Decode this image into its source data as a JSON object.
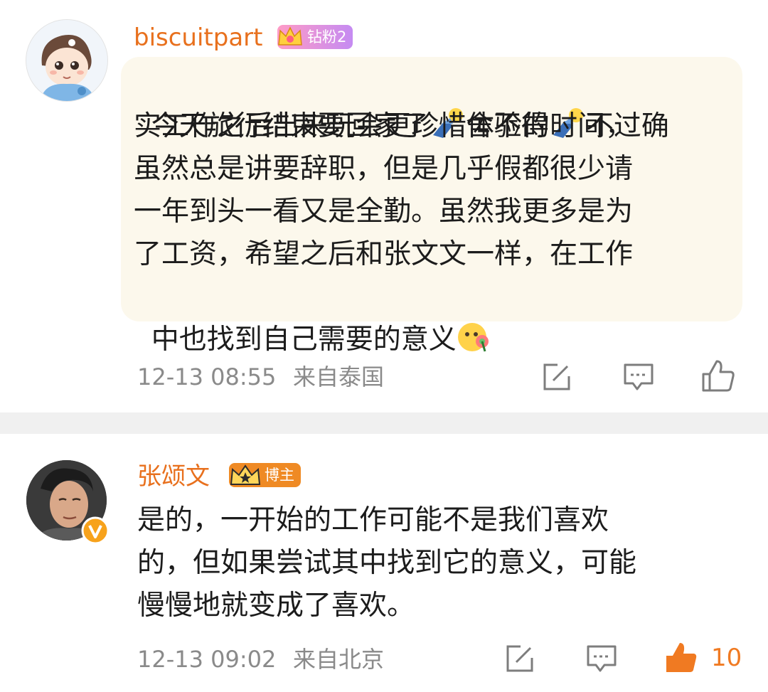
{
  "comment1": {
    "username": "biscuitpart",
    "badge_label": "钻粉2",
    "lines": [
      "今天旅行结束要回家了",
      "实工作之后出来玩会更珍惜体验的时间，",
      "虽然总是讲要辞职，但是几乎假都很少请",
      "一年到头一看又是全勤。虽然我更多是为",
      "了工资，希望之后和张文文一样，在工作",
      "中也找到自己需要的意义"
    ],
    "line1_mid": "舍不得",
    "line1_end": "不过确",
    "timestamp": "12-13 08:55",
    "location": "来自泰国"
  },
  "comment2": {
    "username": "张颂文",
    "badge_label": "博主",
    "lines": [
      "是的，一开始的工作可能不是我们喜欢",
      "的，但如果尝试其中找到它的意义，可能",
      "慢慢地就变成了喜欢。"
    ],
    "timestamp": "12-13 09:02",
    "location": "来自北京",
    "like_count": "10"
  },
  "colors": {
    "username": "#e8701d",
    "bubble": "#fcf8ec",
    "meta": "#8a8a8a",
    "liked": "#f07a22",
    "divider": "#f0f0f0"
  },
  "icons": [
    "edit-icon",
    "comment-icon",
    "like-icon",
    "liked-icon",
    "verified-icon",
    "crown-badge-icon",
    "doll-emoji",
    "pinwheel-emoji"
  ]
}
